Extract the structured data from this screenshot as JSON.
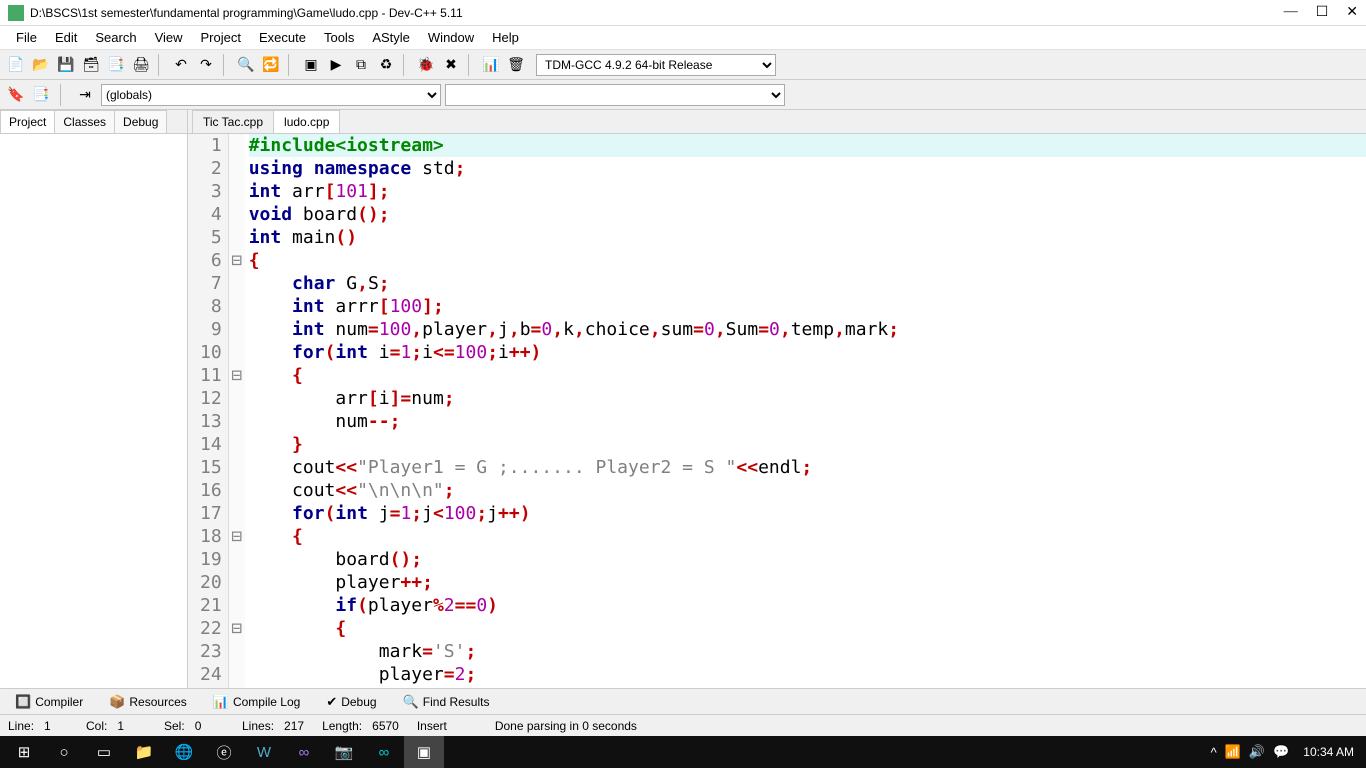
{
  "window": {
    "title": "D:\\BSCS\\1st semester\\fundamental programming\\Game\\ludo.cpp - Dev-C++ 5.11"
  },
  "menu": [
    "File",
    "Edit",
    "Search",
    "View",
    "Project",
    "Execute",
    "Tools",
    "AStyle",
    "Window",
    "Help"
  ],
  "compiler_select": "TDM-GCC 4.9.2 64-bit Release",
  "globals_select": "(globals)",
  "sidebar_tabs": [
    "Project",
    "Classes",
    "Debug"
  ],
  "file_tabs": [
    "Tic Tac.cpp",
    "ludo.cpp"
  ],
  "active_file": "ludo.cpp",
  "code": {
    "lines": [
      {
        "n": 1,
        "hl": true,
        "fold": "",
        "tokens": [
          [
            "pre",
            "#include<iostream>"
          ]
        ]
      },
      {
        "n": 2,
        "fold": "",
        "tokens": [
          [
            "kw",
            "using"
          ],
          [
            "ident",
            " "
          ],
          [
            "kw",
            "namespace"
          ],
          [
            "ident",
            " std"
          ],
          [
            "op",
            ";"
          ]
        ]
      },
      {
        "n": 3,
        "fold": "",
        "tokens": [
          [
            "kw",
            "int"
          ],
          [
            "ident",
            " arr"
          ],
          [
            "op",
            "["
          ],
          [
            "num",
            "101"
          ],
          [
            "op",
            "];"
          ]
        ]
      },
      {
        "n": 4,
        "fold": "",
        "tokens": [
          [
            "kw",
            "void"
          ],
          [
            "ident",
            " board"
          ],
          [
            "op",
            "();"
          ]
        ]
      },
      {
        "n": 5,
        "fold": "",
        "tokens": [
          [
            "kw",
            "int"
          ],
          [
            "ident",
            " main"
          ],
          [
            "op",
            "()"
          ]
        ]
      },
      {
        "n": 6,
        "fold": "⊟",
        "tokens": [
          [
            "brace",
            "{"
          ]
        ]
      },
      {
        "n": 7,
        "fold": "",
        "tokens": [
          [
            "ident",
            "    "
          ],
          [
            "kw",
            "char"
          ],
          [
            "ident",
            " G"
          ],
          [
            "op",
            ","
          ],
          [
            "ident",
            "S"
          ],
          [
            "op",
            ";"
          ]
        ]
      },
      {
        "n": 8,
        "fold": "",
        "tokens": [
          [
            "ident",
            "    "
          ],
          [
            "kw",
            "int"
          ],
          [
            "ident",
            " arrr"
          ],
          [
            "op",
            "["
          ],
          [
            "num",
            "100"
          ],
          [
            "op",
            "];"
          ]
        ]
      },
      {
        "n": 9,
        "fold": "",
        "tokens": [
          [
            "ident",
            "    "
          ],
          [
            "kw",
            "int"
          ],
          [
            "ident",
            " num"
          ],
          [
            "op",
            "="
          ],
          [
            "num",
            "100"
          ],
          [
            "op",
            ","
          ],
          [
            "ident",
            "player"
          ],
          [
            "op",
            ","
          ],
          [
            "ident",
            "j"
          ],
          [
            "op",
            ","
          ],
          [
            "ident",
            "b"
          ],
          [
            "op",
            "="
          ],
          [
            "num",
            "0"
          ],
          [
            "op",
            ","
          ],
          [
            "ident",
            "k"
          ],
          [
            "op",
            ","
          ],
          [
            "ident",
            "choice"
          ],
          [
            "op",
            ","
          ],
          [
            "ident",
            "sum"
          ],
          [
            "op",
            "="
          ],
          [
            "num",
            "0"
          ],
          [
            "op",
            ","
          ],
          [
            "ident",
            "Sum"
          ],
          [
            "op",
            "="
          ],
          [
            "num",
            "0"
          ],
          [
            "op",
            ","
          ],
          [
            "ident",
            "temp"
          ],
          [
            "op",
            ","
          ],
          [
            "ident",
            "mark"
          ],
          [
            "op",
            ";"
          ]
        ]
      },
      {
        "n": 10,
        "fold": "",
        "tokens": [
          [
            "ident",
            "    "
          ],
          [
            "kw",
            "for"
          ],
          [
            "op",
            "("
          ],
          [
            "kw",
            "int"
          ],
          [
            "ident",
            " i"
          ],
          [
            "op",
            "="
          ],
          [
            "num",
            "1"
          ],
          [
            "op",
            ";"
          ],
          [
            "ident",
            "i"
          ],
          [
            "op",
            "<="
          ],
          [
            "num",
            "100"
          ],
          [
            "op",
            ";"
          ],
          [
            "ident",
            "i"
          ],
          [
            "op",
            "++)"
          ]
        ]
      },
      {
        "n": 11,
        "fold": "⊟",
        "tokens": [
          [
            "ident",
            "    "
          ],
          [
            "brace",
            "{"
          ]
        ]
      },
      {
        "n": 12,
        "fold": "",
        "tokens": [
          [
            "ident",
            "        arr"
          ],
          [
            "op",
            "["
          ],
          [
            "ident",
            "i"
          ],
          [
            "op",
            "]="
          ],
          [
            "ident",
            "num"
          ],
          [
            "op",
            ";"
          ]
        ]
      },
      {
        "n": 13,
        "fold": "",
        "tokens": [
          [
            "ident",
            "        num"
          ],
          [
            "op",
            "--;"
          ]
        ]
      },
      {
        "n": 14,
        "fold": "",
        "tokens": [
          [
            "ident",
            "    "
          ],
          [
            "brace",
            "}"
          ]
        ]
      },
      {
        "n": 15,
        "fold": "",
        "tokens": [
          [
            "ident",
            "    cout"
          ],
          [
            "op",
            "<<"
          ],
          [
            "str",
            "\"Player1 = G ;....... Player2 = S \""
          ],
          [
            "op",
            "<<"
          ],
          [
            "ident",
            "endl"
          ],
          [
            "op",
            ";"
          ]
        ]
      },
      {
        "n": 16,
        "fold": "",
        "tokens": [
          [
            "ident",
            "    cout"
          ],
          [
            "op",
            "<<"
          ],
          [
            "str",
            "\"\\n\\n\\n\""
          ],
          [
            "op",
            ";"
          ]
        ]
      },
      {
        "n": 17,
        "fold": "",
        "tokens": [
          [
            "ident",
            "    "
          ],
          [
            "kw",
            "for"
          ],
          [
            "op",
            "("
          ],
          [
            "kw",
            "int"
          ],
          [
            "ident",
            " j"
          ],
          [
            "op",
            "="
          ],
          [
            "num",
            "1"
          ],
          [
            "op",
            ";"
          ],
          [
            "ident",
            "j"
          ],
          [
            "op",
            "<"
          ],
          [
            "num",
            "100"
          ],
          [
            "op",
            ";"
          ],
          [
            "ident",
            "j"
          ],
          [
            "op",
            "++)"
          ]
        ]
      },
      {
        "n": 18,
        "fold": "⊟",
        "tokens": [
          [
            "ident",
            "    "
          ],
          [
            "brace",
            "{"
          ]
        ]
      },
      {
        "n": 19,
        "fold": "",
        "tokens": [
          [
            "ident",
            "        board"
          ],
          [
            "op",
            "();"
          ]
        ]
      },
      {
        "n": 20,
        "fold": "",
        "tokens": [
          [
            "ident",
            "        player"
          ],
          [
            "op",
            "++;"
          ]
        ]
      },
      {
        "n": 21,
        "fold": "",
        "tokens": [
          [
            "ident",
            "        "
          ],
          [
            "kw",
            "if"
          ],
          [
            "op",
            "("
          ],
          [
            "ident",
            "player"
          ],
          [
            "op",
            "%"
          ],
          [
            "num",
            "2"
          ],
          [
            "op",
            "=="
          ],
          [
            "num",
            "0"
          ],
          [
            "op",
            ")"
          ]
        ]
      },
      {
        "n": 22,
        "fold": "⊟",
        "tokens": [
          [
            "ident",
            "        "
          ],
          [
            "brace",
            "{"
          ]
        ]
      },
      {
        "n": 23,
        "fold": "",
        "tokens": [
          [
            "ident",
            "            mark"
          ],
          [
            "op",
            "="
          ],
          [
            "str",
            "'S'"
          ],
          [
            "op",
            ";"
          ]
        ]
      },
      {
        "n": 24,
        "fold": "",
        "tokens": [
          [
            "ident",
            "            player"
          ],
          [
            "op",
            "="
          ],
          [
            "num",
            "2"
          ],
          [
            "op",
            ";"
          ]
        ]
      }
    ]
  },
  "bottom_tabs": [
    {
      "icon": "🔲",
      "label": "Compiler"
    },
    {
      "icon": "📦",
      "label": "Resources"
    },
    {
      "icon": "📊",
      "label": "Compile Log"
    },
    {
      "icon": "✔",
      "label": "Debug"
    },
    {
      "icon": "🔍",
      "label": "Find Results"
    }
  ],
  "status": {
    "line_label": "Line:",
    "line": "1",
    "col_label": "Col:",
    "col": "1",
    "sel_label": "Sel:",
    "sel": "0",
    "lines_label": "Lines:",
    "lines": "217",
    "length_label": "Length:",
    "length": "6570",
    "mode": "Insert",
    "parse": "Done parsing in 0 seconds"
  },
  "taskbar": {
    "clock": "10:34 AM"
  }
}
